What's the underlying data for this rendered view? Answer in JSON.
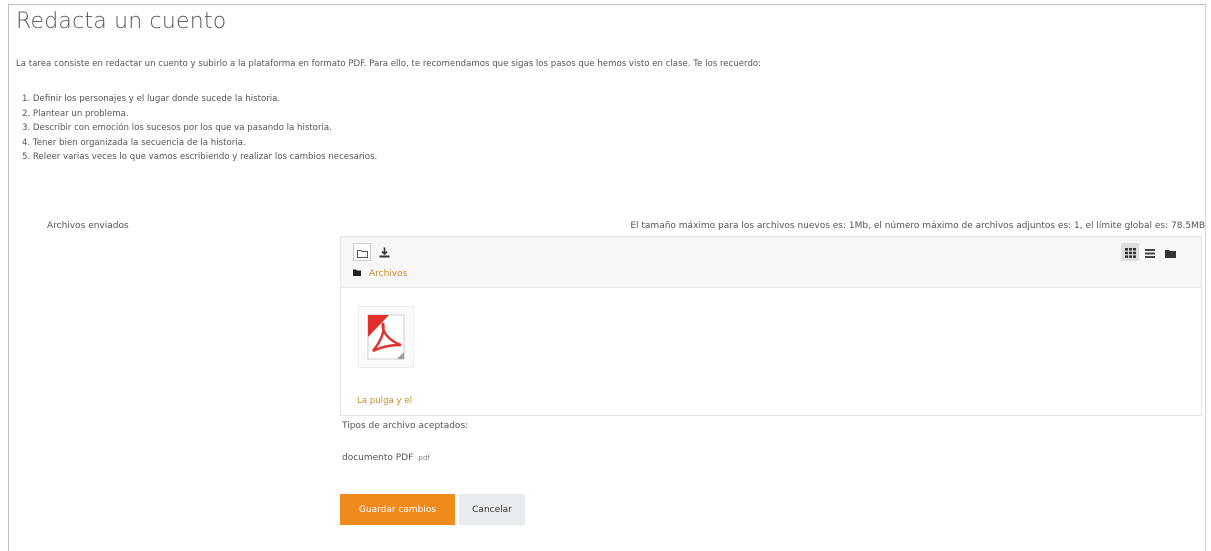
{
  "page": {
    "title": "Redacta un cuento",
    "intro": "La tarea consiste en redactar un cuento y subirlo a la plataforma en formato PDF. Para ello, te recomendamos que sigas los pasos que hemos visto en clase. Te los recuerdo:",
    "steps": [
      "1. Definir los personajes y el lugar donde sucede la historia.",
      "2. Plantear un problema.",
      "3. Describir con emoción los sucesos por los que va pasando la historia.",
      "4. Tener bien organizada la secuencia de la historia.",
      "5. Releer varias veces lo que vamos escribiendo y realizar los cambios necesarios."
    ]
  },
  "submission": {
    "label": "Archivos enviados",
    "limits": "El tamaño máximo para los archivos nuevos es: 1Mb, el número máximo de archivos adjuntos es: 1, el límite global es: 78.5MB",
    "toolbar": {
      "add_icon": "folder-outline-icon",
      "download_icon": "download-icon",
      "views": [
        "grid-view-icon",
        "list-view-icon",
        "folder-view-icon"
      ],
      "active_view": "grid-view-icon"
    },
    "breadcrumb": "Archivos",
    "files": [
      {
        "name": "La pulga y el",
        "icon": "pdf-file-icon"
      }
    ],
    "accepted_label": "Tipos de archivo aceptados:",
    "accepted_type": "documento PDF",
    "accepted_ext": ".pdf"
  },
  "actions": {
    "save": "Guardar cambios",
    "cancel": "Cancelar"
  },
  "colors": {
    "accent": "#f08a1d",
    "link": "#c58d2a",
    "pdf_red": "#e3302a"
  }
}
